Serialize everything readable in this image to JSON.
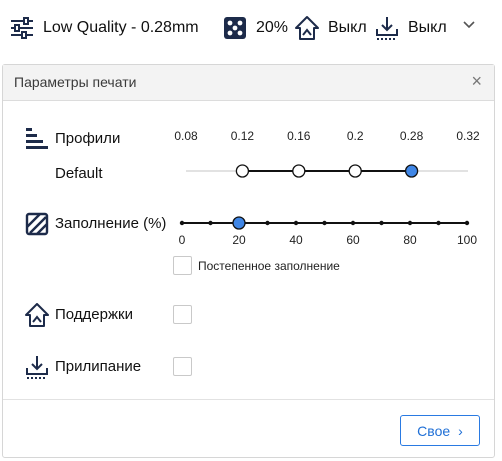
{
  "topbar": {
    "profile_label": "Low Quality - 0.28mm",
    "infill_value": "20%",
    "support_value": "Выкл",
    "adhesion_value": "Выкл"
  },
  "panel": {
    "title": "Параметры печати",
    "close_glyph": "×"
  },
  "profiles": {
    "label": "Профили",
    "sub_label": "Default",
    "ticks": [
      "0.08",
      "0.12",
      "0.16",
      "0.2",
      "0.28",
      "0.32"
    ],
    "available": [
      "0.12",
      "0.16",
      "0.2",
      "0.28"
    ],
    "selected": "0.28"
  },
  "infill": {
    "label": "Заполнение (%)",
    "ticks": [
      "0",
      "20",
      "40",
      "60",
      "80",
      "100"
    ],
    "min": 0,
    "max": 100,
    "step": 10,
    "value": 20,
    "gradual_label": "Постепенное заполнение",
    "gradual_checked": false
  },
  "support": {
    "label": "Поддержки",
    "checked": false
  },
  "adhesion": {
    "label": "Прилипание",
    "checked": false
  },
  "footer": {
    "custom_button_label": "Свое",
    "custom_button_chevron": "›"
  },
  "colors": {
    "accent": "#3f86e6",
    "text": "#111111",
    "icon": "#1d2b4a"
  }
}
